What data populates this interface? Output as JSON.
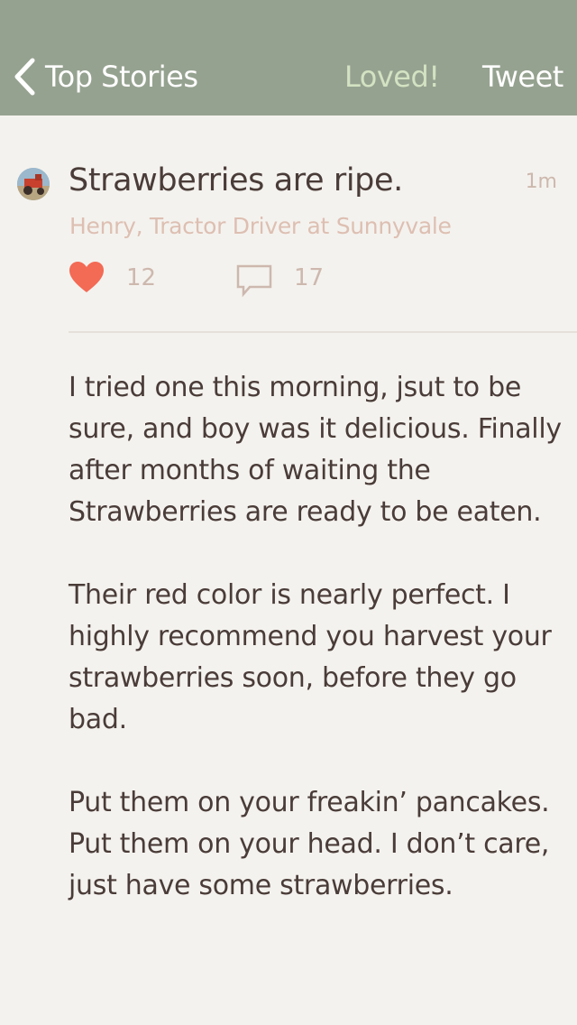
{
  "nav": {
    "back_label": "Top Stories",
    "loved_label": "Loved!",
    "tweet_label": "Tweet"
  },
  "post": {
    "title": "Strawberries are ripe.",
    "timestamp": "1m",
    "author": "Henry, Tractor Driver at Sunnyvale",
    "love_count": "12",
    "comment_count": "17",
    "paragraphs": [
      "I tried one this morning, jsut to be sure, and boy was it delicious. Finally after months of waiting the Strawberries are ready to be eaten.",
      "Their red color is nearly perfect. I highly recommend you harvest your strawberries soon, before they go bad.",
      "Put them on your freakin’ pancakes. Put them on your head. I don’t care, just have some strawberries."
    ]
  },
  "colors": {
    "navbar": "#96a290",
    "background": "#f4f2ee",
    "heart": "#f36a55",
    "loved": "#d3e2c2"
  }
}
